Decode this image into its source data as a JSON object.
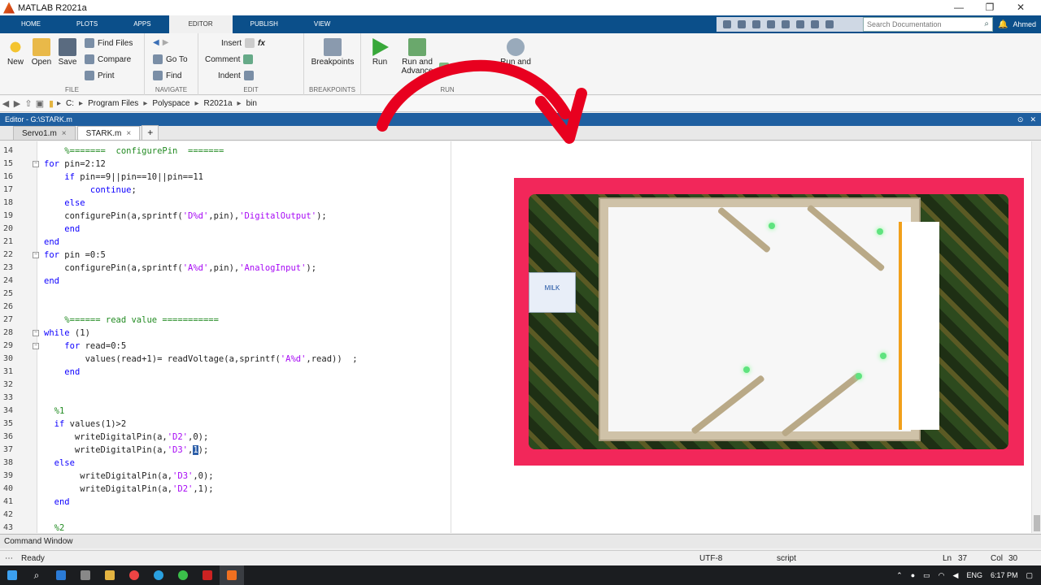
{
  "window": {
    "title": "MATLAB R2021a",
    "controls": [
      "—",
      "❐",
      "✕"
    ]
  },
  "tabs": [
    "HOME",
    "PLOTS",
    "APPS",
    "EDITOR",
    "PUBLISH",
    "VIEW"
  ],
  "active_tab": "EDITOR",
  "search": {
    "placeholder": "Search Documentation"
  },
  "user": "Ahmed",
  "ribbon": {
    "file": {
      "label": "FILE",
      "new": "New",
      "open": "Open",
      "save": "Save",
      "find_files": "Find Files",
      "compare": "Compare",
      "print": "Print"
    },
    "navigate": {
      "label": "NAVIGATE",
      "goto": "Go To",
      "find": "Find"
    },
    "edit": {
      "label": "EDIT",
      "insert": "Insert",
      "comment": "Comment",
      "indent": "Indent",
      "fx": "fx"
    },
    "breakpoints": {
      "label": "BREAKPOINTS",
      "btn": "Breakpoints"
    },
    "run": {
      "label": "RUN",
      "run": "Run",
      "run_advance": "Run and Advance",
      "advance": "Advance",
      "run_time": "Run and Time"
    }
  },
  "path": [
    "C:",
    "Program Files",
    "Polyspace",
    "R2021a",
    "bin"
  ],
  "editor": {
    "title": "Editor - G:\\STARK.m",
    "files": [
      "Servo1.m",
      "STARK.m"
    ],
    "active_file": "STARK.m"
  },
  "code": [
    {
      "n": "14",
      "parts": [
        {
          "t": "    ",
          "c": ""
        },
        {
          "t": "%=======  configurePin  =======",
          "c": "cm"
        }
      ]
    },
    {
      "n": "15",
      "fold": "−",
      "parts": [
        {
          "t": "for",
          "c": "kw"
        },
        {
          "t": " pin=2:12",
          "c": ""
        }
      ]
    },
    {
      "n": "16",
      "parts": [
        {
          "t": "    ",
          "c": ""
        },
        {
          "t": "if",
          "c": "kw"
        },
        {
          "t": " pin==9||pin==10||pin==11",
          "c": ""
        }
      ]
    },
    {
      "n": "17",
      "parts": [
        {
          "t": "         ",
          "c": ""
        },
        {
          "t": "continue",
          "c": "kw"
        },
        {
          "t": ";",
          "c": ""
        }
      ]
    },
    {
      "n": "18",
      "parts": [
        {
          "t": "    ",
          "c": ""
        },
        {
          "t": "else",
          "c": "kw"
        }
      ]
    },
    {
      "n": "19",
      "parts": [
        {
          "t": "    configurePin(a,sprintf(",
          "c": ""
        },
        {
          "t": "'D%d'",
          "c": "str"
        },
        {
          "t": ",pin),",
          "c": ""
        },
        {
          "t": "'DigitalOutput'",
          "c": "str"
        },
        {
          "t": ");",
          "c": ""
        }
      ]
    },
    {
      "n": "20",
      "parts": [
        {
          "t": "    ",
          "c": ""
        },
        {
          "t": "end",
          "c": "kw"
        }
      ]
    },
    {
      "n": "21",
      "parts": [
        {
          "t": "end",
          "c": "kw"
        }
      ]
    },
    {
      "n": "22",
      "fold": "−",
      "parts": [
        {
          "t": "for",
          "c": "kw"
        },
        {
          "t": " pin =0:5",
          "c": ""
        }
      ]
    },
    {
      "n": "23",
      "parts": [
        {
          "t": "    configurePin(a,sprintf(",
          "c": ""
        },
        {
          "t": "'A%d'",
          "c": "str"
        },
        {
          "t": ",pin),",
          "c": ""
        },
        {
          "t": "'AnalogInput'",
          "c": "str"
        },
        {
          "t": ");",
          "c": ""
        }
      ]
    },
    {
      "n": "24",
      "parts": [
        {
          "t": "end",
          "c": "kw"
        }
      ]
    },
    {
      "n": "25",
      "parts": []
    },
    {
      "n": "26",
      "parts": []
    },
    {
      "n": "27",
      "parts": [
        {
          "t": "    ",
          "c": ""
        },
        {
          "t": "%====== read value ===========",
          "c": "cm"
        }
      ]
    },
    {
      "n": "28",
      "fold": "−",
      "parts": [
        {
          "t": "while",
          "c": "kw"
        },
        {
          "t": " (1)",
          "c": ""
        }
      ]
    },
    {
      "n": "29",
      "fold": "−",
      "parts": [
        {
          "t": "    ",
          "c": ""
        },
        {
          "t": "for",
          "c": "kw"
        },
        {
          "t": " read=0:5",
          "c": ""
        }
      ]
    },
    {
      "n": "30",
      "parts": [
        {
          "t": "        values(read+1)= readVoltage(a,sprintf(",
          "c": ""
        },
        {
          "t": "'A%d'",
          "c": "str"
        },
        {
          "t": ",read))  ;",
          "c": ""
        }
      ]
    },
    {
      "n": "31",
      "parts": [
        {
          "t": "    ",
          "c": ""
        },
        {
          "t": "end",
          "c": "kw"
        }
      ]
    },
    {
      "n": "32",
      "parts": []
    },
    {
      "n": "33",
      "parts": []
    },
    {
      "n": "34",
      "parts": [
        {
          "t": "  ",
          "c": ""
        },
        {
          "t": "%1",
          "c": "cm"
        }
      ]
    },
    {
      "n": "35",
      "parts": [
        {
          "t": "  ",
          "c": ""
        },
        {
          "t": "if",
          "c": "kw"
        },
        {
          "t": " values(1)>2",
          "c": ""
        }
      ]
    },
    {
      "n": "36",
      "parts": [
        {
          "t": "      writeDigitalPin(a,",
          "c": ""
        },
        {
          "t": "'D2'",
          "c": "str"
        },
        {
          "t": ",0);",
          "c": ""
        }
      ]
    },
    {
      "n": "37",
      "parts": [
        {
          "t": "      writeDigitalPin(a,",
          "c": ""
        },
        {
          "t": "'D3'",
          "c": "str"
        },
        {
          "t": ",",
          "c": ""
        },
        {
          "t": "1",
          "c": "sel"
        },
        {
          "t": ");",
          "c": ""
        }
      ]
    },
    {
      "n": "38",
      "parts": [
        {
          "t": "  ",
          "c": ""
        },
        {
          "t": "else",
          "c": "kw"
        }
      ]
    },
    {
      "n": "39",
      "parts": [
        {
          "t": "       writeDigitalPin(a,",
          "c": ""
        },
        {
          "t": "'D3'",
          "c": "str"
        },
        {
          "t": ",0);",
          "c": ""
        }
      ]
    },
    {
      "n": "40",
      "parts": [
        {
          "t": "       writeDigitalPin(a,",
          "c": ""
        },
        {
          "t": "'D2'",
          "c": "str"
        },
        {
          "t": ",1);",
          "c": ""
        }
      ]
    },
    {
      "n": "41",
      "parts": [
        {
          "t": "  ",
          "c": ""
        },
        {
          "t": "end",
          "c": "kw"
        }
      ]
    },
    {
      "n": "42",
      "parts": []
    },
    {
      "n": "43",
      "parts": [
        {
          "t": "  ",
          "c": ""
        },
        {
          "t": "%2",
          "c": "cm"
        }
      ]
    }
  ],
  "photo": {
    "milk_label": "MILK"
  },
  "command_window": "Command Window",
  "status": {
    "ready": "Ready",
    "encoding": "UTF-8",
    "type": "script",
    "ln_label": "Ln",
    "ln": "37",
    "col_label": "Col",
    "col": "30"
  },
  "taskbar": {
    "lang": "ENG",
    "time": "6:17 PM"
  },
  "colors": {
    "accent": "#0b4f8a",
    "arrow": "#e8001f",
    "frame": "#f2275a"
  }
}
